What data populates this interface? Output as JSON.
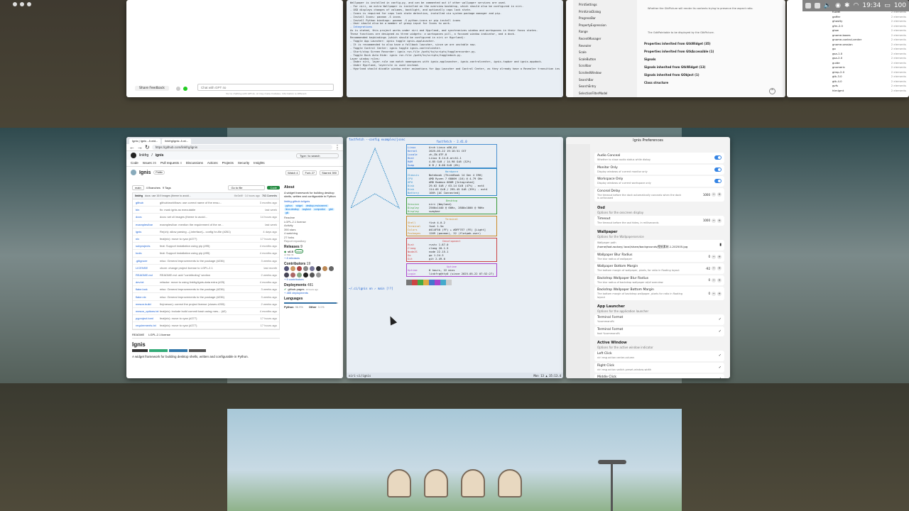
{
  "topbar": {
    "clock": "19:34",
    "battery": "100",
    "workspace_count": 3
  },
  "chat": {
    "feedback": "Share Feedback",
    "placeholder": "Chat with GPT 4o",
    "disclaimer": "You're chatting with GPT-4o. AI may make mistakes. Information is different."
  },
  "doc": {
    "lines": [
      "Wallpaper is installed in config.py, and can be commented out if other wallpaper services are used.",
      "  - For niri, an extra Wallpaper is installed on the overview backdrop, which should also be configured in niri.",
      "",
      "- OSD displays changes of volumes, backlight, and optionally caps lock state.",
      "  - Icons is required for caps lock state detection, installed via system package manager and pip.",
      "    - Install Icons: pacman -S icons",
      "    - Install Python bindings: pacman -S python-icons or pip install icons",
      "",
      "- User should also be a member of group input for Icons to work.",
      "",
      "- Integrations",
      "",
      "As is stated, this project works under niri and Hyprland, and synchronizes window and workspaces in their focus states.",
      "These functions are designed as three widgets: a workspaces pill, a focused window indicator, and a dock.",
      "Recommended keybindings (which should be configured in niri or Hyprland):",
      "  - Toggle App Launcher: ignis toggle ignis-applauncher.",
      "    - It is recommended to also have a fallback launcher, since we are unstable now.",
      "",
      "  - Toggle Control Center: ignis toggle ignis-controlcenter.",
      "  - Start/stop Screen Recorder: ignis run-file /path/to/scripts/togglerecorder.py.",
      "  - Toggle Dock Auto Hide: ignis run-file /path/to/scripts/toggledock.py.",
      "",
      "Layer window rules:",
      "  - Under niri, layer-rule can match namespaces with ignis-applauncher, ignis-controlcenter, ignis-topbar and ignis-appdock.",
      "  - Under Hyprland, layerrule is used instead.",
      "  - Hyprland should disable window enter animations for App Launcher and Control Center, as they already have a Revealer transition inside."
    ]
  },
  "gtk": {
    "sidebar": [
      "PrintSettings",
      "PrintUnixDialog",
      "ProgressBar",
      "PropertyExpression",
      "Range",
      "RecentManager",
      "Revealer",
      "Scale",
      "ScaleButton",
      "Scrollbar",
      "ScrolledWindow",
      "SearchBar",
      "SearchEntry",
      "SelectionFilterModel"
    ],
    "items": [
      "Properties inherited from GtkWidget (35)",
      "Properties inherited from GtkAccessible (1)",
      "Signals",
      "Signals inherited from GtkWidget (13)",
      "Signals inherited from GObject (1)",
      "Class structure"
    ],
    "note": "Whether the GtkPicture will render its contents trying to preserve the aspect ratio.",
    "note2": "The GdkPaintable to be displayed by the GtkPicture."
  },
  "icons": {
    "names": [
      "fuzzel",
      "gaffer",
      "ghostty",
      "gfm-2.0",
      "glow",
      "gnome-boxes",
      "gnome-control-center",
      "gnome-session",
      "go",
      "gsa-1.0",
      "gsa-2.0",
      "guide",
      "gnumeric",
      "gimp-2.0",
      "gtk-3.0",
      "gtk-4.0",
      "gvfs",
      "htmlgmt"
    ],
    "counts": "2 elements"
  },
  "github": {
    "tab1": "Ignis | Ignis - A wid...",
    "tab2": "linkfrg/ignis: A wi...",
    "url": "https://github.com/linkfrg/ignis",
    "owner": "linkfrg",
    "repo": "ignis",
    "search": "Type / to search",
    "nav": [
      "Code",
      "Issues",
      "Pull requests",
      "Discussions",
      "Actions",
      "Projects",
      "Security",
      "Insights"
    ],
    "nav_counts": {
      "Issues": "26",
      "Pull requests": "4"
    },
    "repo_title": "Ignis",
    "visibility": "Public",
    "watch": "Watch",
    "watch_n": "4",
    "fork": "Fork",
    "fork_n": "27",
    "star": "Starred",
    "star_n": "390",
    "branch": "main",
    "branches": "4 Branches",
    "tags": "9 Tags",
    "goto": "Go to file",
    "code_btn": "Code",
    "commit_author": "linkfrg",
    "commit_msg": "docs: use 16:9 images (theme to avoid...",
    "commit_meta": "f4e3e8f · 14 hours ago",
    "commits": "763 Commits",
    "files": [
      [
        "github",
        "github/workflows: use correct name of the ensu...",
        "3 months ago"
      ],
      [
        "bin",
        "fix: mark ignis as executable",
        "last week"
      ],
      [
        "docs",
        "docs: set cli images (theme to avoid...",
        "14 hours ago"
      ],
      [
        "examples/bar",
        "examples/bar: mention the requirement of the ne...",
        "last week"
      ],
      [
        "ignis",
        "Re(ch): allow parsing --{-interface}-- config hn-file (#261)",
        "4 days ago"
      ],
      [
        "nix",
        "feat(nix): move to ryan (#277)",
        "17 hours ago"
      ],
      [
        "subprojects",
        "feat: Support installation using pip (#95)",
        "4 months ago"
      ],
      [
        "tools",
        "feat: Support installation using pip (#95)",
        "4 months ago"
      ],
      [
        ".gitignore",
        "misc: General improvements to the package (#236)",
        "3 weeks ago"
      ],
      [
        "LICENSE",
        "chore: change project license to LGPL-2.1",
        "last month"
      ],
      [
        "README.md",
        "README.md: add \"contributing\" section",
        "2 weeks ago"
      ],
      [
        "dev.txt",
        "refactor: move to using linkfrg/ignis-data extra (#25)",
        "4 months ago"
      ],
      [
        "flake.lock",
        "misc: General improvements to the package (#236)",
        "3 weeks ago"
      ],
      [
        "flake.nix",
        "misc: General improvements to the package (#236)",
        "3 weeks ago"
      ],
      [
        "meson.build",
        "fix(meson): correct the project license (closes #205)",
        "2 weeks ago"
      ],
      [
        "meson_options.txt",
        "feat(nix): include build commit hash using mes... (#2)",
        "4 months ago"
      ],
      [
        "pyproject.toml",
        "feat(nix): move to ryan (#277)",
        "17 hours ago"
      ],
      [
        "requirements.txt",
        "feat(nix): move to ryan (#277)",
        "17 hours ago"
      ]
    ],
    "readme_tab": "README",
    "license_tab": "LGPL-2.1 license",
    "readme_title": "Ignis",
    "readme_desc": "A widget framework for building desktop shells, written and configurable in Python.",
    "about_title": "About",
    "about_desc": "A widget framework for building desktop shells, written and configurable in Python",
    "about_link": "linkfrg.github.io/ignis",
    "topics": [
      "python",
      "widget",
      "desktop-environment",
      "linux-desktop",
      "wayland",
      "compositor",
      "gtk4",
      "gtk"
    ],
    "about_items": [
      "Readme",
      "LGPL-2.1 license",
      "Activity",
      "390 stars",
      "4 watching",
      "27 forks"
    ],
    "report": "Report repository",
    "releases": "Releases",
    "releases_n": "9",
    "release_tag": "v0.5",
    "release_latest": "Latest",
    "release_date": "on Mar 31",
    "more_releases": "+ 8 releases",
    "contributors": "Contributors",
    "contributors_n": "19",
    "more_contrib": "+ 5 contributors",
    "deployments": "Deployments",
    "deployments_n": "481",
    "deploy_item": "github-pages",
    "deploy_time": "13 hours ago",
    "more_deploy": "+ 480 deployments",
    "languages": "Languages",
    "langs": [
      [
        "Python",
        "96.9%"
      ],
      [
        "Other",
        "3.1%"
      ]
    ]
  },
  "term": {
    "prompt": "fastfetch --config examples/jsonc",
    "version": "fastfetch - 2.41.0",
    "sections": [
      {
        "title": "Hardware",
        "rows": [
          [
            "Chassis",
            "Notebook (ThinkBook 14 Gen 4 IRH)"
          ],
          [
            "CPU",
            "AMD Ryzen 7 6800H (16) @ 4.79 GHz"
          ],
          [
            "GPU",
            "AMD Radeon 680M [Integrated]"
          ],
          [
            "Disk",
            "29.62 GiB / 63.14 GiB (47%) - ext4"
          ],
          [
            "Disk",
            "114.05 GiB / 295.45 GiB (39%) - ext4"
          ],
          [
            "Battery",
            "100% [AC Connected]"
          ]
        ]
      },
      {
        "title": "Desktop",
        "rows": [
          [
            "Session",
            "niri (Wayland)"
          ],
          [
            "Display",
            "2560x1440 @ 60Hz, 2880x1800 @ 90Hz"
          ],
          [
            "Display",
            "swaybar"
          ]
        ]
      },
      {
        "title": "Terminal",
        "rows": [
          [
            "Shell",
            "fish 4.0.2"
          ],
          [
            "Terminal",
            "foot 1.5a"
          ],
          [
            "Colors",
            "#414F50 (FF) + #DFF7E7 (FE) [Light]"
          ],
          [
            "Packages",
            "1269 (pacman), 32 (flatpak-user)"
          ]
        ]
      },
      {
        "title": "Development",
        "rows": [
          [
            "Rust",
            "rustc 1.87.0"
          ],
          [
            "Clang",
            "clang 20.1.5"
          ],
          [
            "NodeJS",
            "node 22.15.1"
          ],
          [
            "Go",
            "go 1.24.3"
          ],
          [
            "Git",
            "git 2.49.0"
          ]
        ]
      },
      {
        "title": "Uptime",
        "rows": [
          [
            "Uptime",
            "8 hours, 22 mins"
          ],
          [
            "Login",
            "linkfrg@tty0 (since 2025-05-22 07:52:27)"
          ]
        ]
      }
    ],
    "top_rows": [
      [
        "Linux",
        "Arch Linux x86_64"
      ],
      [
        "Kernel",
        "2025-05-22 19:16:51 CST"
      ],
      [
        "Locale",
        "zh_CN.UTF-8"
      ],
      [
        "Host",
        "Linux 6.14.6-arch1-1"
      ],
      [
        "RAM",
        "4.85 GiB / 14.98 GiB (32%)"
      ],
      [
        "Swap",
        "0 B / 8.00 GiB (0%)"
      ]
    ],
    "prompt2": "~/.ci/ignis on ✓ main [!?]",
    "footer_left": "niri-ci/ignis",
    "footer_right": "Mon 13 ▲ 35:13.4"
  },
  "prefs": {
    "title": "Ignis Preferences",
    "rows": [
      [
        "Audio Conceal",
        "Whether to show audio status while dialog",
        "on"
      ],
      [
        "Monitor Only",
        "Display windows of current monitor only",
        "on"
      ],
      [
        "Workspace Only",
        "Display windows of current workspace only",
        "on"
      ],
      [
        "Conceal Delay",
        "The timeout before the dock automatically conceals when the dock is unfocused",
        "1000"
      ]
    ],
    "osd_head": "Osd",
    "osd_sub": "Options for the onscreen display",
    "timeout": "Timeout",
    "timeout_sub": "The timeout before the osd hides, in milliseconds",
    "timeout_v": "1000",
    "wall_head": "Wallpaper",
    "wall_sub": "Options for the Wallpaperservice",
    "wall_path_lbl": "Wallpaper path",
    "wall_path": "/home/foot-wolsey/.local/share/backgrounds/壁纸素材-1-202505.jpg",
    "wall_rows": [
      [
        "Wallpaper Blur Radius",
        "The blur radius of wallpaper",
        "0"
      ],
      [
        "Wallpaper Bottom Margin",
        "The bottom margin of wallpaper, pixels, for ratio in floating layout",
        "-92"
      ],
      [
        "Backdrop Wallpaper Blur Radius",
        "The blur radius of backdrop wallpaper at/of overview",
        "0"
      ],
      [
        "Backdrop Wallpaper Bottom Margin",
        "The bottom margin of backdrop wallpaper, pixels for ratio in floating layout",
        "0"
      ]
    ],
    "app_head": "App Launcher",
    "app_sub": "Options for the application launcher",
    "app_rows": [
      [
        "Terminal Format",
        "%command%"
      ],
      [
        "Terminal Format",
        "foot %command%"
      ]
    ],
    "aw_head": "Active Window",
    "aw_sub": "Options for the active window indicator",
    "aw_rows": [
      [
        "Left Click",
        "niri msg action center-column"
      ],
      [
        "Right Click",
        "niri msg action switch-preset-window-width"
      ],
      [
        "Middle Click",
        "niri msg action toggle-column-tabbed-display"
      ],
      [
        "Scroll Up",
        "niri msg action focus-window-up-or-column-left"
      ]
    ]
  }
}
